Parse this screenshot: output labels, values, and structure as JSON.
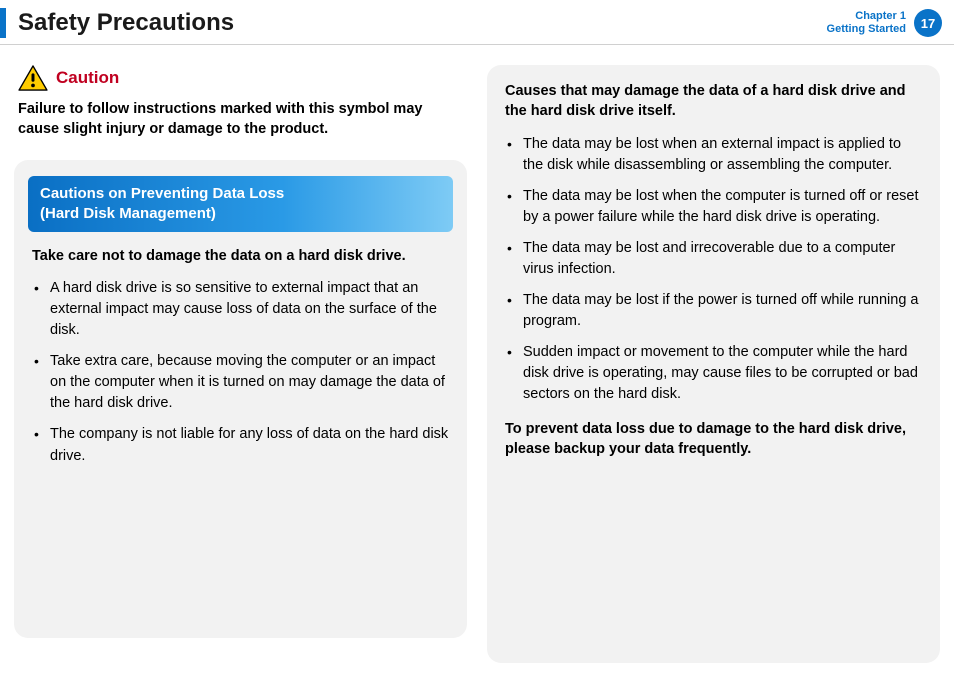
{
  "header": {
    "title": "Safety Precautions",
    "chapter_line1": "Chapter 1",
    "chapter_line2": "Getting Started",
    "page_number": "17"
  },
  "left": {
    "caution_label": "Caution",
    "caution_text": "Failure to follow instructions marked with this symbol may cause slight injury or damage to the product.",
    "sub_header": "Cautions on Preventing Data Loss\n(Hard Disk Management)",
    "intro": "Take care not to damage the data on a hard disk drive.",
    "bullets": [
      "A hard disk drive is so sensitive to external impact that an external impact may cause loss of data on the surface of the disk.",
      "Take extra care, because moving the computer or an impact on the computer when it is turned on may damage the data of the hard disk drive.",
      "The company is not liable for any loss of data on the hard disk drive."
    ]
  },
  "right": {
    "intro": "Causes that may damage the data of a hard disk drive and the hard disk drive itself.",
    "bullets": [
      "The data may be lost when an external impact is applied to the disk while disassembling or assembling the computer.",
      "The data may be lost when the computer is turned off or reset by a power failure while the hard disk drive is operating.",
      "The data may be lost and irrecoverable due to a computer virus infection.",
      "The data may be lost if the power is turned off while running a program.",
      "Sudden impact or movement to the computer while the hard disk drive is operating, may cause files to be corrupted or bad sectors on the hard disk."
    ],
    "closing": "To prevent data loss due to damage to the hard disk drive, please backup your data frequently."
  }
}
